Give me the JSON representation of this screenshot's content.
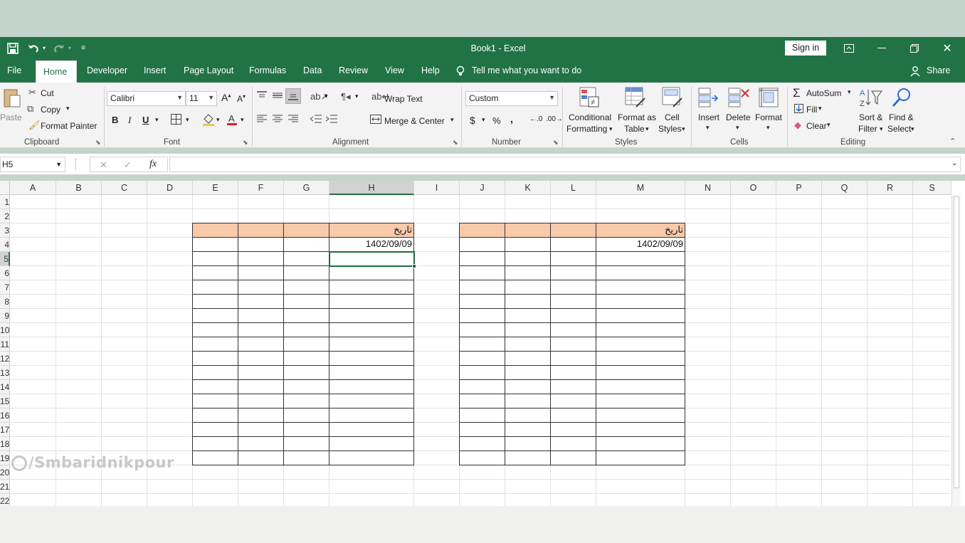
{
  "title_bar": {
    "title": "Book1  -  Excel",
    "sign_in": "Sign in",
    "icons": [
      "save-icon",
      "undo-icon",
      "redo-icon",
      "customize-qat-icon",
      "ribbon-display-icon",
      "minimize-icon",
      "restore-icon",
      "close-icon"
    ]
  },
  "tabs": {
    "file": "File",
    "home": "Home",
    "developer": "Developer",
    "insert": "Insert",
    "page_layout": "Page Layout",
    "formulas": "Formulas",
    "data": "Data",
    "review": "Review",
    "view": "View",
    "help": "Help",
    "tell_me": "Tell me what you want to do",
    "share": "Share"
  },
  "ribbon": {
    "clipboard": {
      "paste": "Paste",
      "cut": "Cut",
      "copy": "Copy",
      "format_painter": "Format Painter",
      "label": "Clipboard"
    },
    "font": {
      "name": "Calibri",
      "size": "11",
      "bold": "B",
      "italic": "I",
      "underline": "U",
      "label": "Font"
    },
    "alignment": {
      "wrap_text": "Wrap Text",
      "merge_center": "Merge & Center",
      "label": "Alignment"
    },
    "number": {
      "format": "Custom",
      "currency": "$",
      "percent": "%",
      "comma": ",",
      "label": "Number"
    },
    "styles": {
      "conditional_1": "Conditional",
      "conditional_2": "Formatting",
      "format_as_1": "Format as",
      "format_as_2": "Table",
      "cell_1": "Cell",
      "cell_2": "Styles",
      "label": "Styles"
    },
    "cells": {
      "insert": "Insert",
      "delete": "Delete",
      "format": "Format",
      "label": "Cells"
    },
    "editing": {
      "autosum": "AutoSum",
      "fill": "Fill",
      "clear": "Clear",
      "sort_1": "Sort &",
      "sort_2": "Filter",
      "find_1": "Find &",
      "find_2": "Select",
      "label": "Editing"
    }
  },
  "formula_bar": {
    "name_box": "H5",
    "fx": "fx",
    "formula": ""
  },
  "grid": {
    "columns": [
      "A",
      "B",
      "C",
      "D",
      "E",
      "F",
      "G",
      "H",
      "I",
      "J",
      "K",
      "L",
      "M",
      "N",
      "O",
      "P",
      "Q",
      "R",
      "S"
    ],
    "rows": [
      "1",
      "2",
      "3",
      "4",
      "5",
      "6",
      "7",
      "8",
      "9",
      "10",
      "11",
      "12",
      "13",
      "14",
      "15",
      "16",
      "17",
      "18",
      "19",
      "20",
      "21",
      "22"
    ],
    "selected_cell": "H5",
    "table1": {
      "header": "تاریخ",
      "date": "1402/09/09"
    },
    "table2": {
      "header": "تاریخ",
      "date": "1402/09/09"
    },
    "header_fill_color": "#f9c9ab"
  },
  "watermark": "/Smbaridnikpour",
  "colors": {
    "excel_green": "#217346",
    "ribbon_bg": "#f3f3f3"
  }
}
